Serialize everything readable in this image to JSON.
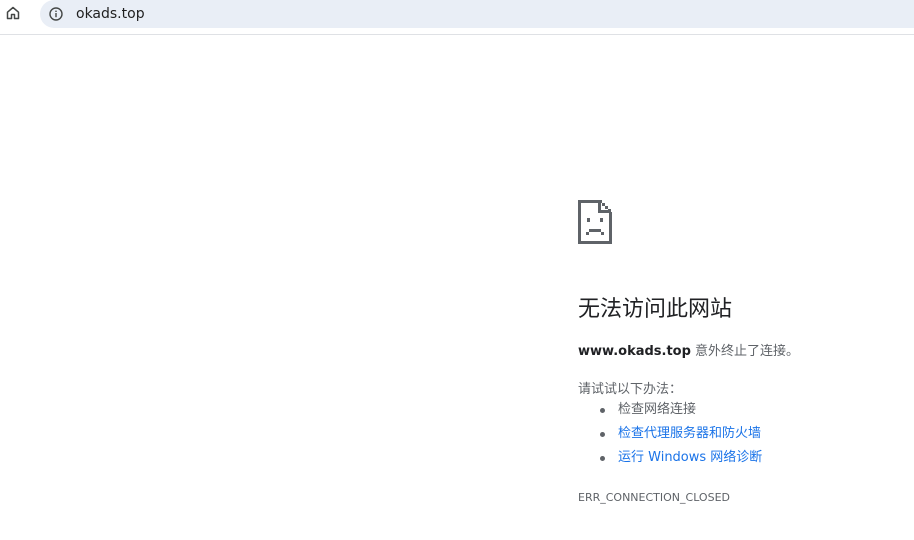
{
  "toolbar": {
    "home_icon": "home-icon",
    "site_info_icon": "info-icon",
    "url": "okads.top"
  },
  "error": {
    "icon": "sad-page-icon",
    "title": "无法访问此网站",
    "host": "www.okads.top",
    "message": " 意外终止了连接。",
    "try_label": "请试试以下办法：",
    "suggestions": [
      {
        "label": "检查网络连接",
        "link": false
      },
      {
        "label": "检查代理服务器和防火墙",
        "link": true
      },
      {
        "label": "运行 Windows 网络诊断",
        "link": true
      }
    ],
    "code": "ERR_CONNECTION_CLOSED"
  },
  "colors": {
    "omnibox_bg": "#e9eef6",
    "link": "#1a73e8",
    "text_secondary": "#5f6368",
    "text_primary": "#202124"
  }
}
